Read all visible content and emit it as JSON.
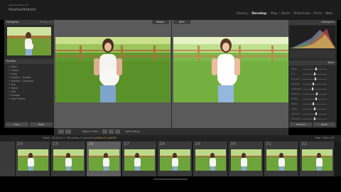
{
  "app": {
    "brand_small": "www.website.com",
    "brand_name": "HeatherRoltord"
  },
  "modules": [
    {
      "label": "Library",
      "active": false
    },
    {
      "label": "Develop",
      "active": true
    },
    {
      "label": "Map",
      "active": false
    },
    {
      "label": "Book",
      "active": false
    },
    {
      "label": "Slideshow",
      "active": false
    },
    {
      "label": "Print",
      "active": false
    },
    {
      "label": "Web",
      "active": false
    }
  ],
  "left_panel": {
    "navigator_label": "Navigator",
    "navigator_zoom": "FIT  FILL  1:1",
    "presets_label": "Presets",
    "presets": [
      "+ B&W",
      "+ Classic",
      "+ Color",
      "+ Heather - Presets",
      "+ Heather - Signature",
      "+ Film",
      "+ Matte",
      "+ Soft",
      "+ Vintage",
      "+ User Presets"
    ],
    "copy_label": "Copy...",
    "paste_label": "Paste"
  },
  "view": {
    "before_label": "Before",
    "after_label": "After"
  },
  "toolbar": {
    "view_label": "Before & After :",
    "soft_proofing_label": "Soft Proofing"
  },
  "right_panel": {
    "histogram_label": "Histogram",
    "basic_label": "Basic",
    "sliders": [
      {
        "label": "Temp",
        "value": 0.55
      },
      {
        "label": "Tint",
        "value": 0.5
      },
      {
        "label": "Exposure",
        "value": 0.52
      },
      {
        "label": "Contrast",
        "value": 0.45
      },
      {
        "label": "Highlights",
        "value": 0.4
      },
      {
        "label": "Shadows",
        "value": 0.6
      },
      {
        "label": "Whites",
        "value": 0.55
      },
      {
        "label": "Blacks",
        "value": 0.45
      },
      {
        "label": "Clarity",
        "value": 0.5
      },
      {
        "label": "Vibrance",
        "value": 0.55
      },
      {
        "label": "Saturation",
        "value": 0.5
      }
    ],
    "previous_label": "Previous",
    "reset_label": "Reset"
  },
  "filmstrip_bar": {
    "source": "Folder : 2018-05-07",
    "count": "184 photos /1 selected",
    "filename": "/untitled-27-of-65.PG",
    "filter_label": "Filter :",
    "filter_value": "Filters Off"
  },
  "filmstrip": {
    "numbers": [
      "24",
      "25",
      "26",
      "27",
      "28",
      "29",
      "30",
      "31",
      "32"
    ],
    "selected_index": 2
  }
}
